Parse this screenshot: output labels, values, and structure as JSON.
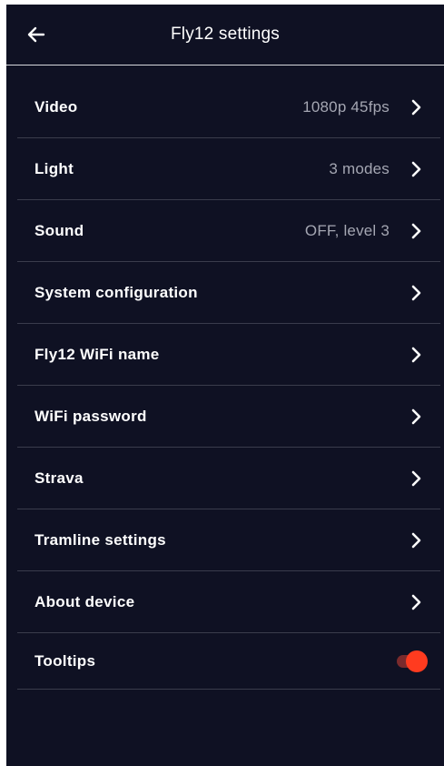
{
  "header": {
    "title": "Fly12 settings",
    "back_icon": "arrow-left-icon"
  },
  "rows": [
    {
      "label": "Video",
      "value": "1080p 45fps",
      "icon": "chevron-right-icon"
    },
    {
      "label": "Light",
      "value": "3 modes",
      "icon": "chevron-right-icon"
    },
    {
      "label": "Sound",
      "value": "OFF, level 3",
      "icon": "chevron-right-icon"
    },
    {
      "label": "System configuration",
      "value": "",
      "icon": "chevron-right-icon"
    },
    {
      "label": "Fly12 WiFi name",
      "value": "",
      "icon": "chevron-right-icon"
    },
    {
      "label": "WiFi password",
      "value": "",
      "icon": "chevron-right-icon"
    },
    {
      "label": "Strava",
      "value": "",
      "icon": "chevron-right-icon"
    },
    {
      "label": "Tramline settings",
      "value": "",
      "icon": "chevron-right-icon"
    },
    {
      "label": "About device",
      "value": "",
      "icon": "chevron-right-icon"
    }
  ],
  "tooltips": {
    "label": "Tooltips",
    "enabled": true
  },
  "colors": {
    "background": "#0f1123",
    "divider": "#3a3c4c",
    "text": "#ffffff",
    "secondary_text": "#a4a6b2",
    "accent": "#ff3b1f"
  }
}
